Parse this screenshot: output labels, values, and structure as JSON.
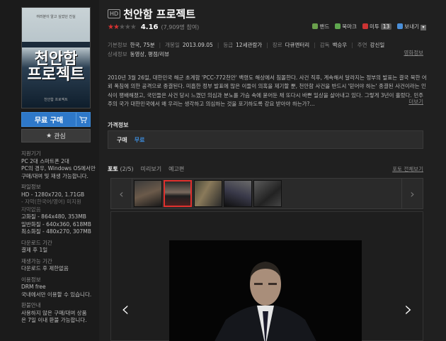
{
  "poster": {
    "top_text": "여러분이 알고 싶었던 진실",
    "title_line1": "천안함",
    "title_line2": "프로젝트",
    "foot_text": "천안함 프로젝트"
  },
  "actions": {
    "buy_label": "무료 구매",
    "wish_label": "관심"
  },
  "side": [
    {
      "head": "지원기기",
      "lines": [
        "PC 2대 스마트폰 2대",
        "PC의 경우, Windows OS에서만",
        "구매/대여 및 재생 가능합니다."
      ]
    },
    {
      "head": "파일정보",
      "lines": [
        "HD - 1280x720, 1.71GB"
      ],
      "dim": [
        "- 자막(한국어/영어) 미지원",
        "자막없음"
      ],
      "lines2": [
        "고화질 - 864x480, 353MB",
        "일반화질 - 640x360, 618MB",
        "최소화질 - 480x270, 307MB"
      ]
    },
    {
      "head": "다운로드 기간",
      "lines": [
        "결제 후 1일"
      ]
    },
    {
      "head": "재생가능 기간",
      "lines": [
        "다운로드 후 제한없음"
      ]
    },
    {
      "head": "이용정보",
      "lines": [
        "DRM free",
        "국내에서만 이용할 수 있습니다."
      ]
    },
    {
      "head": "환불안내",
      "lines": [
        "사용하지 않은 구매/대여 상품",
        "은 7일 이내 환불 가능합니다."
      ]
    }
  ],
  "header": {
    "hd": "HD",
    "title": "천안함 프로젝트",
    "score": "4.16",
    "votes": "(7,909명 참여)",
    "rating": 2.1
  },
  "share": {
    "band": "밴드",
    "bookmark": "북마크",
    "mitu": "미투",
    "mitu_count": "13",
    "send": "보내기"
  },
  "meta": {
    "row1": [
      {
        "k": "기본정보",
        "v": "한국, 75분"
      },
      {
        "k": "개봉일",
        "v": "2013.09.05"
      },
      {
        "k": "등급",
        "v": "12세관람가"
      },
      {
        "k": "장르",
        "v": "다큐멘터리"
      },
      {
        "k": "감독",
        "v": "백승우"
      },
      {
        "k": "주연",
        "v": "강신일"
      }
    ],
    "row2": [
      {
        "k": "상세정보",
        "v": "동영상, 평점/리뷰"
      }
    ],
    "detail_link": "영화정보"
  },
  "synopsis": "2010년 3월 26일, 대한민국 해군 초계함 'PCC-772천안' 백령도 해상에서 침몰한다. 사건 직후, 계속해서 달라지는 정부의 발표는 결국 북한 어뢰 폭침에 의한 공격으로 종결된다. 미흡한 정부 발표에 많은 이들이 의혹을 제기할 뿐, 천안함 사건을 반드시 '믿어야 하는' 종결된 사건이라는 인식이 팽배해졌고, 국민들은 사건 당시 느꼈던 의심과 분노를 가슴 속에 묻어둔 채 또다시 바쁜 일상을 살아내고 있다. 그렇게 3년이 흘렀다. 민주주의 국가 대한민국에서 왜 우리는 생각하고 의심하는 것을 포기하도록 강요 받아야 하는가?...",
  "more_link": "더보기",
  "price": {
    "heading": "가격정보",
    "label": "구매",
    "value": "무료"
  },
  "media": {
    "tabs": [
      {
        "label": "포토",
        "num": "(2/5)",
        "active": true
      },
      {
        "label": "미리보기",
        "active": false
      },
      {
        "label": "예고편",
        "active": false
      }
    ],
    "tab_right": "포토 전체보기"
  }
}
